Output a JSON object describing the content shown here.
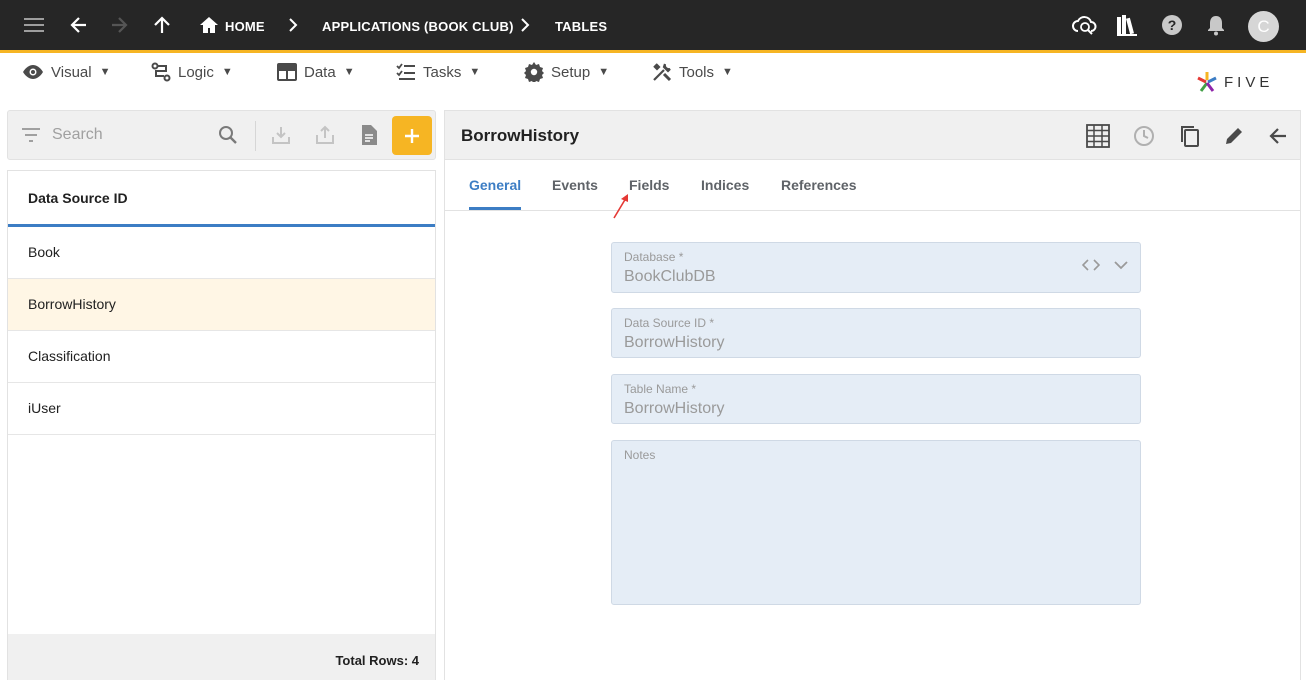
{
  "topbar": {
    "breadcrumbs": [
      "HOME",
      "APPLICATIONS (BOOK CLUB)",
      "TABLES"
    ],
    "avatar_letter": "C"
  },
  "menu": {
    "items": [
      {
        "label": "Visual",
        "icon": "eye-icon"
      },
      {
        "label": "Logic",
        "icon": "logic-icon"
      },
      {
        "label": "Data",
        "icon": "table-icon"
      },
      {
        "label": "Tasks",
        "icon": "tasks-icon"
      },
      {
        "label": "Setup",
        "icon": "gear-icon"
      },
      {
        "label": "Tools",
        "icon": "tools-icon"
      }
    ],
    "caret": "▼"
  },
  "logo": {
    "text": "FIVE"
  },
  "list": {
    "search_placeholder": "Search",
    "column_header": "Data Source ID",
    "rows": [
      "Book",
      "BorrowHistory",
      "Classification",
      "iUser"
    ],
    "selected_index": 1,
    "total_rows_label": "Total Rows: 4"
  },
  "detail": {
    "title": "BorrowHistory",
    "tabs": [
      "General",
      "Events",
      "Fields",
      "Indices",
      "References"
    ],
    "active_tab": "General",
    "fields": [
      {
        "label": "Database *",
        "value": "BookClubDB"
      },
      {
        "label": "Data Source ID *",
        "value": "BorrowHistory"
      },
      {
        "label": "Table Name *",
        "value": "BorrowHistory"
      },
      {
        "label": "Notes",
        "value": ""
      }
    ]
  },
  "colors": {
    "accent": "#f6b523",
    "primary": "#3c7dc4",
    "topbar": "#262626",
    "selected_row": "#fff6e5",
    "field_bg": "#e5edf6",
    "annotation_arrow": "#e53935"
  }
}
